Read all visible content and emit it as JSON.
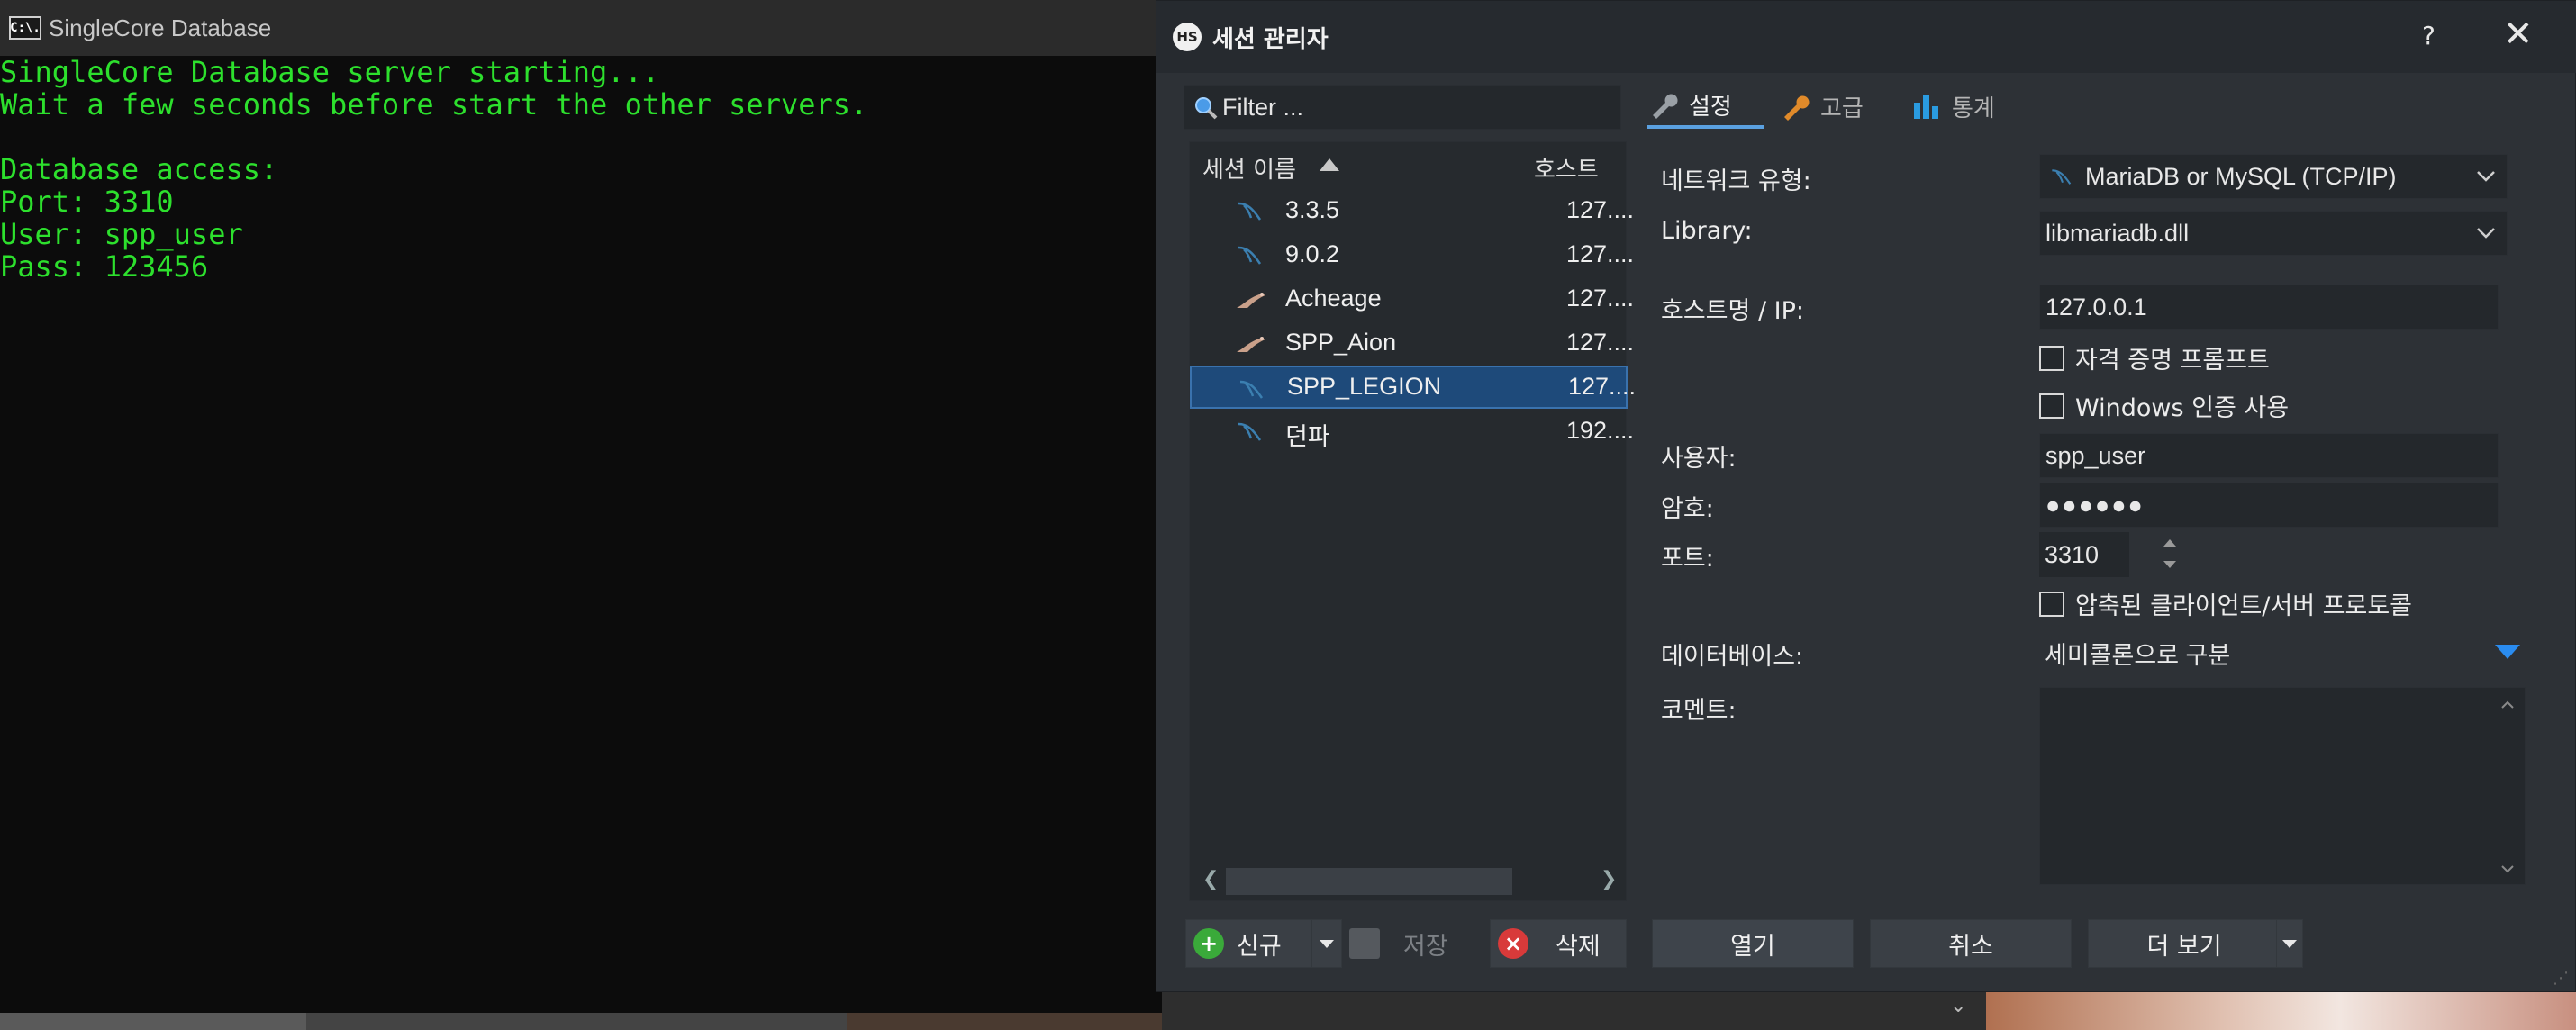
{
  "console": {
    "title": "SingleCore Database",
    "icon_label": "C:\\.",
    "lines": [
      "SingleCore Database server starting...",
      "Wait a few seconds before start the other servers.",
      "",
      "Database access:",
      "Port: 3310",
      "User: spp_user",
      "Pass: 123456"
    ]
  },
  "dialog": {
    "title": "세션 관리자",
    "logo_text": "HS",
    "help_label": "?",
    "close_label": "✕",
    "filter": {
      "placeholder": "Filter ..."
    },
    "tree": {
      "col_name": "세션 이름",
      "col_host": "호스트",
      "rows": [
        {
          "name": "3.3.5",
          "host": "127....",
          "icon": "mysql-dolphin-icon"
        },
        {
          "name": "9.0.2",
          "host": "127....",
          "icon": "mysql-dolphin-icon"
        },
        {
          "name": "Acheage",
          "host": "127....",
          "icon": "mariadb-seal-icon"
        },
        {
          "name": "SPP_Aion",
          "host": "127....",
          "icon": "mariadb-seal-icon"
        },
        {
          "name": "SPP_LEGION",
          "host": "127....",
          "icon": "mysql-dolphin-icon",
          "selected": true
        },
        {
          "name": "던파",
          "host": "192....",
          "icon": "mysql-dolphin-icon"
        }
      ]
    },
    "buttons_left": {
      "new": "신규",
      "save": "저장",
      "delete": "삭제"
    },
    "tabs": [
      {
        "label": "설정",
        "active": true
      },
      {
        "label": "고급",
        "active": false
      },
      {
        "label": "통계",
        "active": false
      }
    ],
    "form": {
      "network_type_label": "네트워크 유형:",
      "network_type_value": "MariaDB or MySQL (TCP/IP)",
      "library_label": "Library:",
      "library_value": "libmariadb.dll",
      "host_label": "호스트명 / IP:",
      "host_value": "127.0.0.1",
      "prompt_credentials_label": "자격 증명 프롬프트",
      "prompt_credentials_checked": false,
      "windows_auth_label": "Windows 인증 사용",
      "windows_auth_checked": false,
      "user_label": "사용자:",
      "user_value": "spp_user",
      "password_label": "암호:",
      "password_mask": "●●●●●●",
      "port_label": "포트:",
      "port_value": "3310",
      "compressed_label": "압축된 클라이언트/서버 프로토콜",
      "compressed_checked": false,
      "database_label": "데이터베이스:",
      "database_value": "세미콜론으로 구분",
      "comment_label": "코멘트:",
      "comment_value": ""
    },
    "buttons_right": {
      "open": "열기",
      "cancel": "취소",
      "more": "더 보기"
    }
  },
  "colors": {
    "console_text": "#2de02d",
    "dialog_bg": "#2d3136",
    "selected_row": "#1e4a7a",
    "accent_blue": "#3a8ee6"
  }
}
